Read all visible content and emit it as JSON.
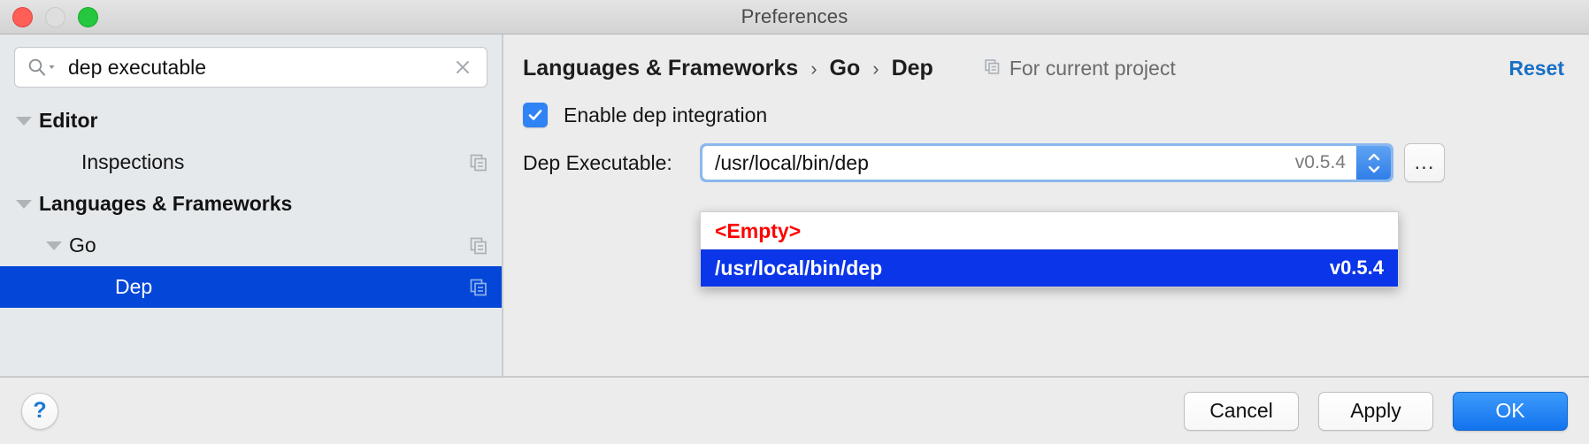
{
  "window": {
    "title": "Preferences",
    "traffic_lights": [
      "close-button",
      "minimize-button",
      "zoom-button"
    ]
  },
  "search": {
    "value": "dep executable",
    "placeholder": "",
    "icon": "search-icon",
    "clear_icon": "clear-icon"
  },
  "sidebar": {
    "items": [
      {
        "label": "Editor",
        "bold": true,
        "indent": 18,
        "arrow": true,
        "selected": false,
        "copy_icon": false
      },
      {
        "label": "Inspections",
        "bold": false,
        "indent": 66,
        "arrow": false,
        "selected": false,
        "copy_icon": true
      },
      {
        "label": "Languages & Frameworks",
        "bold": true,
        "indent": 18,
        "arrow": true,
        "selected": false,
        "copy_icon": false
      },
      {
        "label": "Go",
        "bold": false,
        "indent": 52,
        "arrow": true,
        "selected": false,
        "copy_icon": true
      },
      {
        "label": "Dep",
        "bold": false,
        "indent": 104,
        "arrow": false,
        "selected": true,
        "copy_icon": true
      }
    ]
  },
  "panel": {
    "breadcrumb": {
      "items": [
        "Languages & Frameworks",
        "Go",
        "Dep"
      ],
      "separator": "›"
    },
    "scope": {
      "icon": "copy-settings-icon",
      "label": "For current project"
    },
    "reset_label": "Reset",
    "checkbox": {
      "label": "Enable dep integration",
      "checked": true,
      "check_glyph": "✓"
    },
    "field": {
      "label": "Dep Executable:",
      "value": "/usr/local/bin/dep",
      "version": "v0.5.4",
      "stepper_icon": "stepper-up-down-icon",
      "browse_label": "..."
    },
    "dropdown": {
      "items": [
        {
          "label": "<Empty>",
          "version": "",
          "selected": false,
          "empty": true
        },
        {
          "label": "/usr/local/bin/dep",
          "version": "v0.5.4",
          "selected": true,
          "empty": false
        }
      ]
    }
  },
  "footer": {
    "help_label": "?",
    "cancel_label": "Cancel",
    "apply_label": "Apply",
    "ok_label": "OK"
  },
  "colors": {
    "selection_blue": "#0346d8",
    "dropdown_blue": "#0b35e8",
    "accent_blue": "#1a6fc4",
    "checkbox_blue": "#2f83f4",
    "empty_red": "#ff0000",
    "sidebar_bg": "#e5e9ec",
    "panel_bg": "#ececec"
  }
}
